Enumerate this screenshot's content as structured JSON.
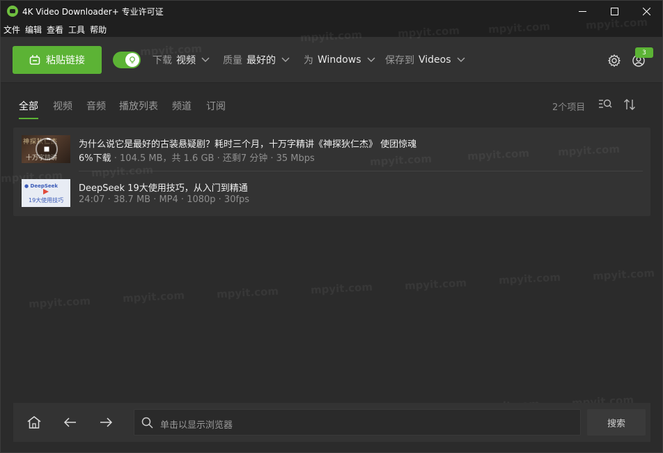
{
  "titlebar": {
    "title": "4K Video Downloader+ 专业许可证",
    "minimize": "minimize",
    "maximize": "maximize",
    "close": "close"
  },
  "menubar": {
    "items": [
      "文件",
      "编辑",
      "查看",
      "工具",
      "帮助"
    ]
  },
  "toolbar": {
    "paste_label": "粘贴链接",
    "smart_mode_on": true,
    "download": {
      "label": "下载",
      "value": "视频"
    },
    "quality": {
      "label": "质量",
      "value": "最好的"
    },
    "platform": {
      "label": "为",
      "value": "Windows"
    },
    "save_to": {
      "label": "保存到",
      "value": "Videos"
    },
    "notification_count": "3",
    "accent_color": "#5cb335"
  },
  "tabs": {
    "items": [
      "全部",
      "视频",
      "音频",
      "播放列表",
      "频道",
      "订阅"
    ],
    "active": "全部",
    "item_count": "2个项目"
  },
  "downloads": [
    {
      "title": "为什么说它是最好的古装悬疑剧？耗时三个月，十万字精讲《神探狄仁杰》 使团惊魂",
      "progress": "6%下载",
      "meta": " · 104.5 MB，共 1.6 GB · 还剩7 分钟 · 35 Mbps",
      "status": "downloading"
    },
    {
      "title": "DeepSeek 19大使用技巧，从入门到精通",
      "meta": "24:07 · 38.7 MB · MP4 · 1080p · 30fps",
      "status": "completed"
    }
  ],
  "browser": {
    "placeholder": "单击以显示浏览器",
    "search_label": "搜索"
  }
}
